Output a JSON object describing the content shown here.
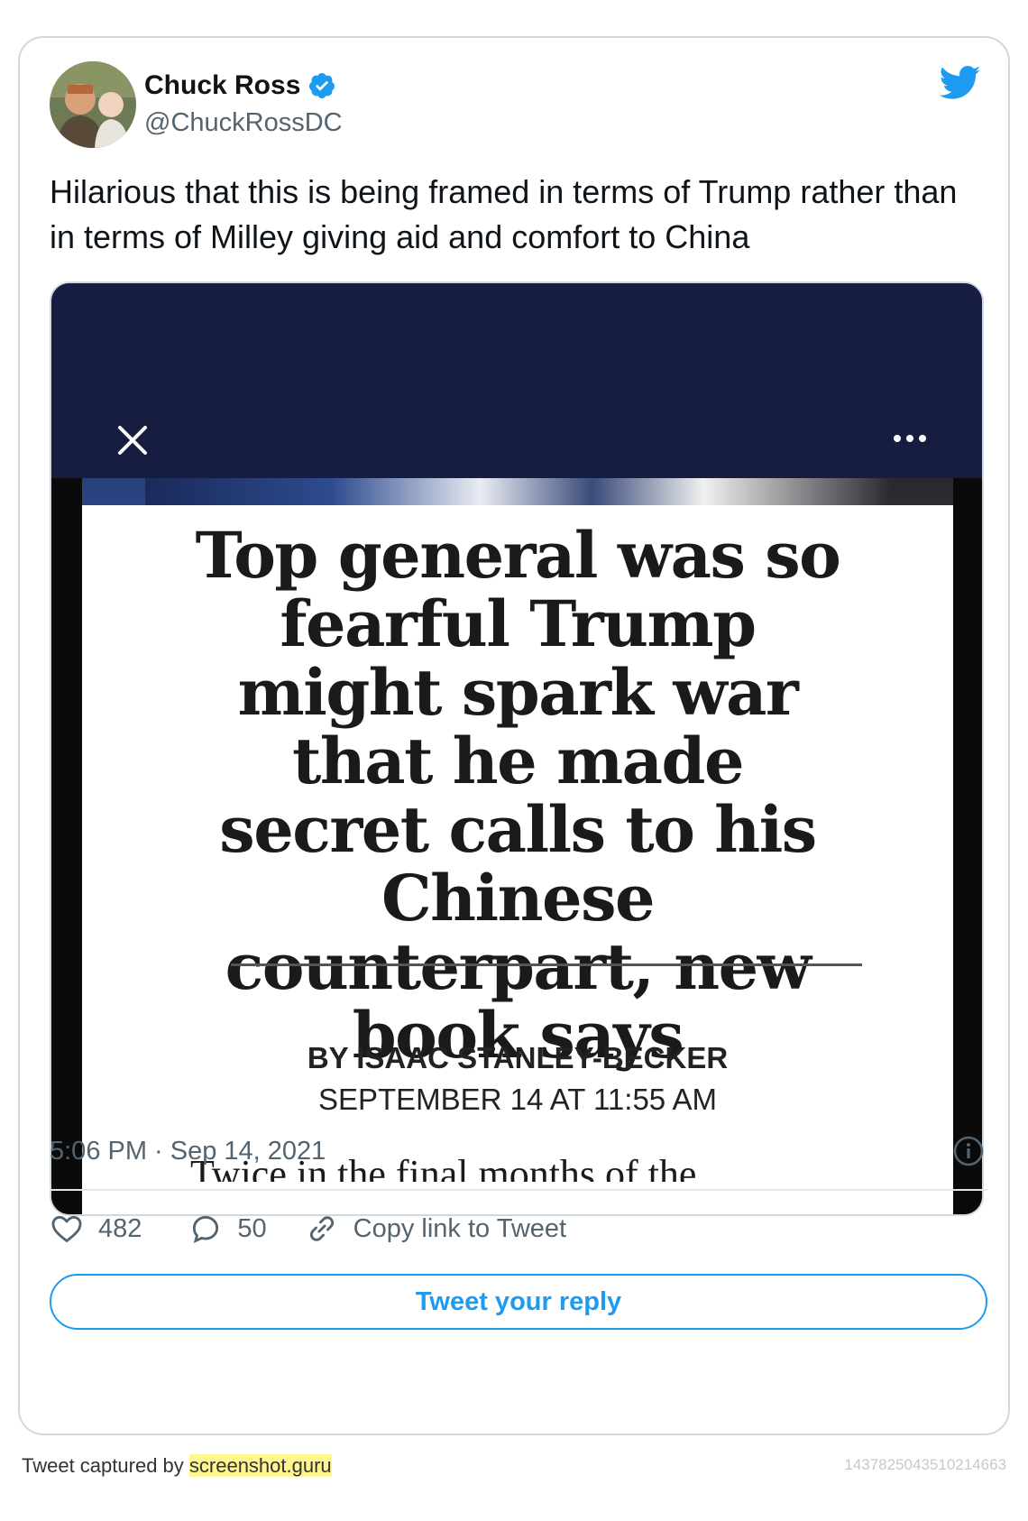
{
  "tweet": {
    "author_name": "Chuck Ross",
    "handle": "@ChuckRossDC",
    "text": "Hilarious that this is being framed in terms of Trump rather than in terms of Milley giving aid and comfort to China",
    "timestamp": "5:06 PM · Sep 14, 2021",
    "likes": "482",
    "replies": "50",
    "copy_link_label": "Copy link to Tweet",
    "reply_button_label": "Tweet your reply",
    "icons": [
      "twitter-bird-icon",
      "verified-badge-icon",
      "close-icon",
      "more-icon",
      "info-icon",
      "heart-icon",
      "reply-icon",
      "link-icon"
    ],
    "accent_color": "#1d9bf0"
  },
  "media": {
    "headline": "Top general was so fearful Trump might spark war that he made secret calls to his Chinese counterpart, new book says",
    "byline": "BY ISAAC STANLEY-BECKER",
    "dateline": "SEPTEMBER 14 AT 11:55 AM",
    "body_start": "Twice in the final months of the"
  },
  "footer": {
    "captured_prefix": "Tweet captured by ",
    "captured_link": "screenshot.guru",
    "tweet_id": "1437825043510214663"
  }
}
